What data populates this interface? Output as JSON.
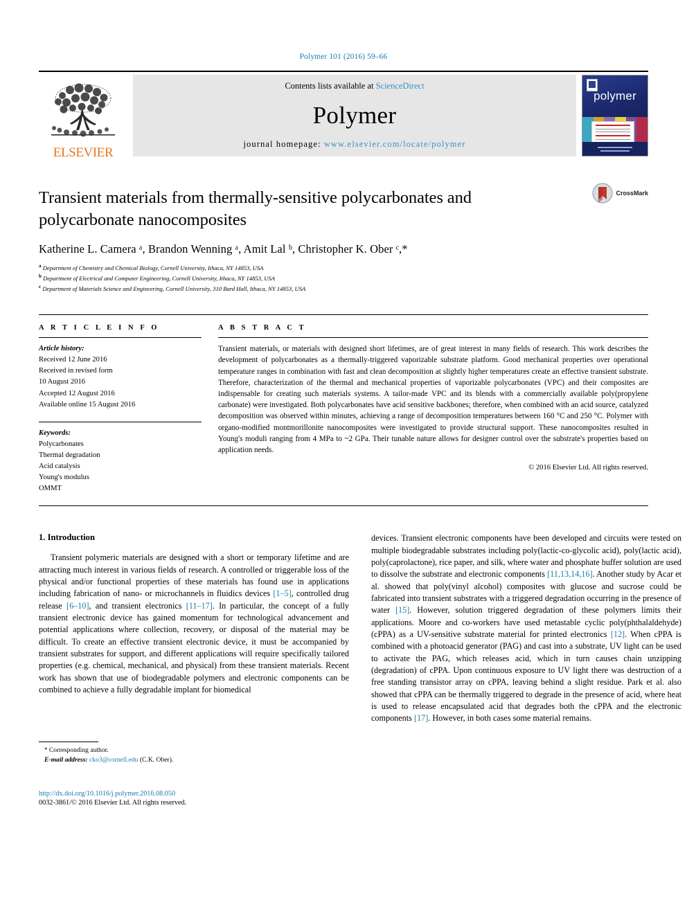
{
  "running_head": "Polymer 101 (2016) 59–66",
  "masthead": {
    "publisher": "ELSEVIER",
    "contents_prefix": "Contents lists available at ",
    "contents_link": "ScienceDirect",
    "journal_name": "Polymer",
    "homepage_prefix": "journal homepage: ",
    "homepage_url": "www.elsevier.com/locate/polymer",
    "cover_title": "polymer"
  },
  "article": {
    "title": "Transient materials from thermally-sensitive polycarbonates and polycarbonate nanocomposites",
    "crossmark_label": "CrossMark",
    "authors": "Katherine L. Camera ᵃ, Brandon Wenning ᵃ, Amit Lal ᵇ, Christopher K. Ober ᶜ,*",
    "affiliations": [
      {
        "mark": "a",
        "text": "Department of Chemistry and Chemical Biology, Cornell University, Ithaca, NY 14853, USA"
      },
      {
        "mark": "b",
        "text": "Department of Electrical and Computer Engineering, Cornell University, Ithaca, NY 14853, USA"
      },
      {
        "mark": "c",
        "text": "Department of Materials Science and Engineering, Cornell University, 310 Bard Hall, Ithaca, NY 14853, USA"
      }
    ]
  },
  "article_info": {
    "heading": "A R T I C L E   I N F O",
    "history_label": "Article history:",
    "history": [
      "Received 12 June 2016",
      "Received in revised form",
      "10 August 2016",
      "Accepted 12 August 2016",
      "Available online 15 August 2016"
    ],
    "keywords_label": "Keywords:",
    "keywords": [
      "Polycarbonates",
      "Thermal degradation",
      "Acid catalysis",
      "Young's modulus",
      "OMMT"
    ]
  },
  "abstract": {
    "heading": "A B S T R A C T",
    "text": "Transient materials, or materials with designed short lifetimes, are of great interest in many fields of research. This work describes the development of polycarbonates as a thermally-triggered vaporizable substrate platform. Good mechanical properties over operational temperature ranges in combination with fast and clean decomposition at slightly higher temperatures create an effective transient substrate. Therefore, characterization of the thermal and mechanical properties of vaporizable polycarbonates (VPC) and their composites are indispensable for creating such materials systems. A tailor-made VPC and its blends with a commercially available poly(propylene carbonate) were investigated. Both polycarbonates have acid sensitive backbones; therefore, when combined with an acid source, catalyzed decomposition was observed within minutes, achieving a range of decomposition temperatures between 160 °C and 250 °C. Polymer with organo-modified montmorillonite nanocomposites were investigated to provide structural support. These nanocomposites resulted in Young's moduli ranging from 4 MPa to ~2 GPa. Their tunable nature allows for designer control over the substrate's properties based on application needs.",
    "copyright": "© 2016 Elsevier Ltd. All rights reserved."
  },
  "introduction": {
    "heading": "1.  Introduction",
    "left_paragraph_1": "Transient polymeric materials are designed with a short or temporary lifetime and are attracting much interest in various fields of research. A controlled or triggerable loss of the physical and/or functional properties of these materials has found use in applications including fabrication of nano- or microchannels in fluidics devices ",
    "left_cite_1": "[1–5]",
    "left_paragraph_2": ", controlled drug release ",
    "left_cite_2": "[6–10]",
    "left_paragraph_3": ", and transient electronics ",
    "left_cite_3": "[11–17]",
    "left_paragraph_4": ". In particular, the concept of a fully transient electronic device has gained momentum for technological advancement and potential applications where collection, recovery, or disposal of the material may be difficult. To create an effective transient electronic device, it must be accompanied by transient substrates for support, and different applications will require specifically tailored properties (e.g. chemical, mechanical, and physical) from these transient materials. Recent work has shown that use of biodegradable polymers and electronic components can be combined to achieve a fully degradable implant for biomedical",
    "right_paragraph_1": "devices. Transient electronic components have been developed and circuits were tested on multiple biodegradable substrates including poly(lactic-co-glycolic acid), poly(lactic acid), poly(caprolactone), rice paper, and silk, where water and phosphate buffer solution are used to dissolve the substrate and electronic components ",
    "right_cite_1": "[11,13,14,16]",
    "right_paragraph_2": ". Another study by Acar et al. showed that poly(vinyl alcohol) composites with glucose and sucrose could be fabricated into transient substrates with a triggered degradation occurring in the presence of water ",
    "right_cite_2": "[15]",
    "right_paragraph_3": ". However, solution triggered degradation of these polymers limits their applications. Moore and co-workers have used metastable cyclic poly(phthalaldehyde) (cPPA) as a UV-sensitive substrate material for printed electronics ",
    "right_cite_3": "[12]",
    "right_paragraph_4": ". When cPPA is combined with a photoacid generator (PAG) and cast into a substrate, UV light can be used to activate the PAG, which releases acid, which in turn causes chain unzipping (degradation) of cPPA. Upon continuous exposure to UV light there was destruction of a free standing transistor array on cPPA, leaving behind a slight residue. Park et al. also showed that cPPA can be thermally triggered to degrade in the presence of acid, where heat is used to release encapsulated acid that degrades both the cPPA and the electronic components ",
    "right_cite_4": "[17]",
    "right_paragraph_5": ". However, in both cases some material remains."
  },
  "footer": {
    "corresponding_star": "*",
    "corresponding_label": "Corresponding author.",
    "email_label": "E-mail address:",
    "email": "cko3@cornell.edu",
    "email_suffix": "(C.K. Ober).",
    "doi": "http://dx.doi.org/10.1016/j.polymer.2016.08.050",
    "issn": "0032-3861/© 2016 Elsevier Ltd. All rights reserved."
  },
  "colors": {
    "link": "#1b7aad",
    "elsevier_orange": "#e87722",
    "cover_blue": "#1f2f7a"
  }
}
